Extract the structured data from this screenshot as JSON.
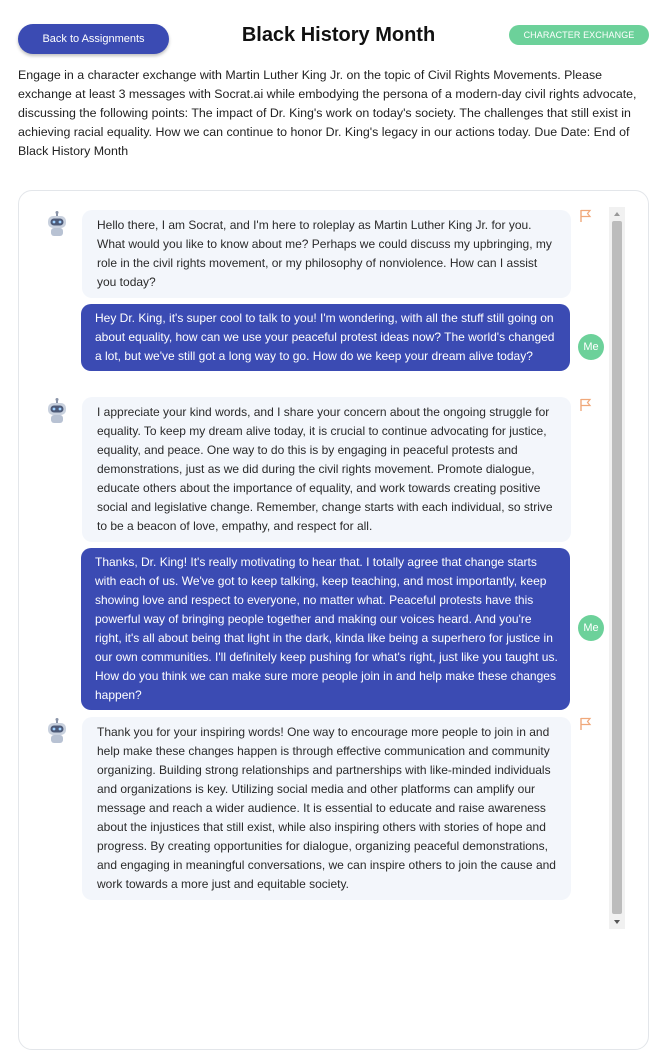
{
  "header": {
    "back_label": "Back to Assignments",
    "title": "Black History Month",
    "badge": "CHARACTER EXCHANGE"
  },
  "assignment": {
    "description": "Engage in a character exchange with Martin Luther King Jr. on the topic of Civil Rights Movements. Please exchange at least 3 messages with Socrat.ai while embodying the persona of a modern-day civil rights advocate, discussing the following points: The impact of Dr. King's work on today's society. The challenges that still exist in achieving racial equality. How we can continue to honor Dr. King's legacy in our actions today. Due Date: End of Black History Month"
  },
  "chat": {
    "user_avatar_label": "Me",
    "messages": [
      {
        "role": "bot",
        "icon": "robot-icon",
        "flag_icon": "flag-icon",
        "text": "Hello there, I am Socrat, and I'm here to roleplay as Martin Luther King Jr. for you. What would you like to know about me? Perhaps we could discuss my upbringing, my role in the civil rights movement, or my philosophy of nonviolence. How can I assist you today?"
      },
      {
        "role": "user",
        "text": "Hey Dr. King, it's super cool to talk to you! I'm wondering, with all the stuff still going on about equality, how can we use your peaceful protest ideas now? The world's changed a lot, but we've still got a long way to go. How do we keep your dream alive today?"
      },
      {
        "role": "bot",
        "icon": "robot-icon",
        "flag_icon": "flag-icon",
        "text": "I appreciate your kind words, and I share your concern about the ongoing struggle for equality. To keep my dream alive today, it is crucial to continue advocating for justice, equality, and peace. One way to do this is by engaging in peaceful protests and demonstrations, just as we did during the civil rights movement. Promote dialogue, educate others about the importance of equality, and work towards creating positive social and legislative change. Remember, change starts with each individual, so strive to be a beacon of love, empathy, and respect for all."
      },
      {
        "role": "user",
        "text": "Thanks, Dr. King! It's really motivating to hear that. I totally agree that change starts with each of us. We've got to keep talking, keep teaching, and most importantly, keep showing love and respect to everyone, no matter what. Peaceful protests have this powerful way of bringing people together and making our voices heard. And you're right, it's all about being that light in the dark, kinda like being a superhero for justice in our own communities. I'll definitely keep pushing for what's right, just like you taught us. How do you think we can make sure more people join in and help make these changes happen?"
      },
      {
        "role": "bot",
        "icon": "robot-icon",
        "flag_icon": "flag-icon",
        "text": "Thank you for your inspiring words! One way to encourage more people to join in and help make these changes happen is through effective communication and community organizing. Building strong relationships and partnerships with like-minded individuals and organizations is key. Utilizing social media and other platforms can amplify our message and reach a wider audience. It is essential to educate and raise awareness about the injustices that still exist, while also inspiring others with stories of hope and progress. By creating opportunities for dialogue, organizing peaceful demonstrations, and engaging in meaningful conversations, we can inspire others to join the cause and work towards a more just and equitable society."
      }
    ]
  },
  "colors": {
    "primary": "#3b4bb3",
    "accent_green": "#6cd19a",
    "bot_bubble": "#f3f6fb",
    "flag": "#f0a87a"
  }
}
